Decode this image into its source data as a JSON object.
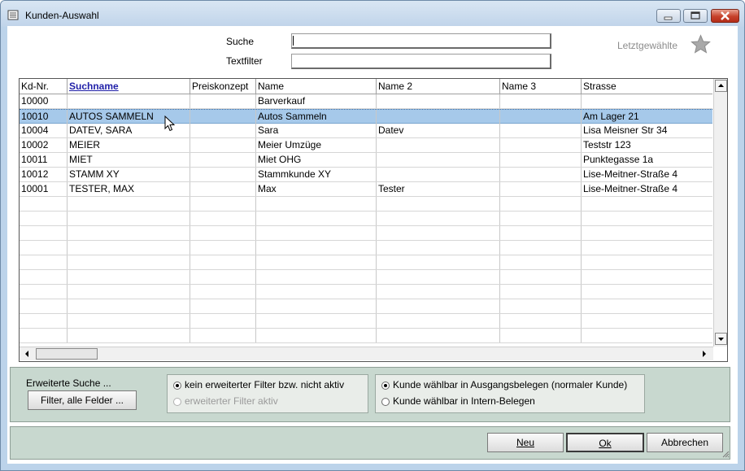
{
  "window": {
    "title": "Kunden-Auswahl"
  },
  "search": {
    "suche_label": "Suche",
    "suche_value": "",
    "textfilter_label": "Textfilter",
    "textfilter_value": "",
    "recent_label": "Letztgewählte"
  },
  "table": {
    "columns": [
      "Kd-Nr.",
      "Suchname",
      "Preiskonzept",
      "Name",
      "Name 2",
      "Name 3",
      "Strasse"
    ],
    "sorted_column": "Suchname",
    "rows": [
      {
        "kdnr": "10000",
        "suchname": "",
        "preiskonzept": "",
        "name": "Barverkauf",
        "name2": "",
        "name3": "",
        "strasse": ""
      },
      {
        "kdnr": "10010",
        "suchname": "AUTOS SAMMELN",
        "preiskonzept": "",
        "name": "Autos Sammeln",
        "name2": "",
        "name3": "",
        "strasse": "Am Lager 21"
      },
      {
        "kdnr": "10004",
        "suchname": "DATEV, SARA",
        "preiskonzept": "",
        "name": "Sara",
        "name2": "Datev",
        "name3": "",
        "strasse": "Lisa Meisner Str 34"
      },
      {
        "kdnr": "10002",
        "suchname": "MEIER",
        "preiskonzept": "",
        "name": "Meier Umzüge",
        "name2": "",
        "name3": "",
        "strasse": "Teststr 123"
      },
      {
        "kdnr": "10011",
        "suchname": "MIET",
        "preiskonzept": "",
        "name": "Miet OHG",
        "name2": "",
        "name3": "",
        "strasse": "Punktegasse 1a"
      },
      {
        "kdnr": "10012",
        "suchname": "STAMM XY",
        "preiskonzept": "",
        "name": "Stammkunde XY",
        "name2": "",
        "name3": "",
        "strasse": "Lise-Meitner-Straße 4"
      },
      {
        "kdnr": "10001",
        "suchname": "TESTER, MAX",
        "preiskonzept": "",
        "name": "Max",
        "name2": "Tester",
        "name3": "",
        "strasse": "Lise-Meitner-Straße 4"
      }
    ],
    "selected_row": 1
  },
  "filters": {
    "extended_label": "Erweiterte Suche ...",
    "filter_button": "Filter, alle Felder ...",
    "filter_options": [
      "kein erweiterter Filter bzw. nicht aktiv",
      "erweiterter Filter aktiv"
    ],
    "filter_selected": 0,
    "filter_disabled": [
      false,
      true
    ],
    "customer_options": [
      "Kunde wählbar in Ausgangsbelegen (normaler Kunde)",
      "Kunde wählbar in Intern-Belegen"
    ],
    "customer_selected": 0
  },
  "buttons": {
    "neu": "Neu",
    "ok": "Ok",
    "abbrechen": "Abbrechen"
  }
}
